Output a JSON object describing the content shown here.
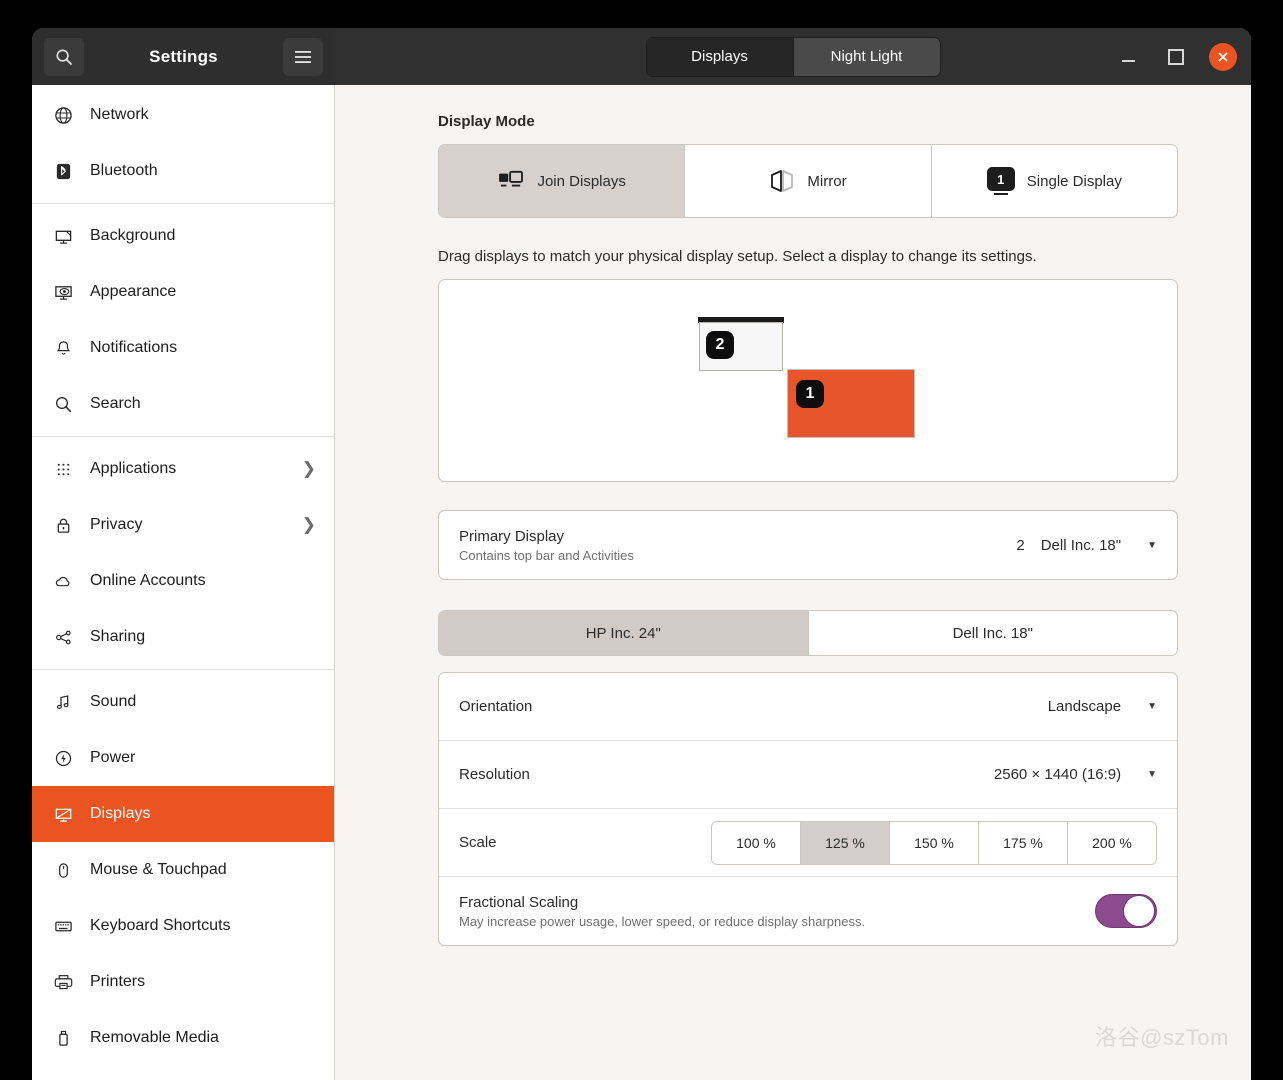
{
  "window": {
    "app_title": "Settings",
    "search_icon": "search-icon",
    "menu_icon": "hamburger-menu-icon",
    "minimize_label": "–",
    "maximize_label": "□",
    "close_label": "✕",
    "accent_color": "#e95420",
    "header_bg": "#303030"
  },
  "header": {
    "tabs": [
      {
        "label": "Displays",
        "active": true
      },
      {
        "label": "Night Light",
        "active": false
      }
    ]
  },
  "sidebar": {
    "groups": [
      {
        "items": [
          {
            "label": "Network",
            "icon": "globe-icon",
            "chevron": false,
            "selected": false
          },
          {
            "label": "Bluetooth",
            "icon": "bluetooth-icon",
            "chevron": false,
            "selected": false
          }
        ]
      },
      {
        "items": [
          {
            "label": "Background",
            "icon": "monitor-wallpaper-icon",
            "chevron": false,
            "selected": false
          },
          {
            "label": "Appearance",
            "icon": "appearance-eye-icon",
            "chevron": false,
            "selected": false
          },
          {
            "label": "Notifications",
            "icon": "bell-icon",
            "chevron": false,
            "selected": false
          },
          {
            "label": "Search",
            "icon": "search-icon",
            "chevron": false,
            "selected": false
          }
        ]
      },
      {
        "items": [
          {
            "label": "Applications",
            "icon": "grid-apps-icon",
            "chevron": true,
            "selected": false
          },
          {
            "label": "Privacy",
            "icon": "lock-icon",
            "chevron": true,
            "selected": false
          },
          {
            "label": "Online Accounts",
            "icon": "cloud-icon",
            "chevron": false,
            "selected": false
          },
          {
            "label": "Sharing",
            "icon": "share-nodes-icon",
            "chevron": false,
            "selected": false
          }
        ]
      },
      {
        "items": [
          {
            "label": "Sound",
            "icon": "music-note-icon",
            "chevron": false,
            "selected": false
          },
          {
            "label": "Power",
            "icon": "power-bolt-icon",
            "chevron": false,
            "selected": false
          },
          {
            "label": "Displays",
            "icon": "displays-icon",
            "chevron": false,
            "selected": true
          },
          {
            "label": "Mouse & Touchpad",
            "icon": "mouse-icon",
            "chevron": false,
            "selected": false
          },
          {
            "label": "Keyboard Shortcuts",
            "icon": "keyboard-icon",
            "chevron": false,
            "selected": false
          },
          {
            "label": "Printers",
            "icon": "printer-icon",
            "chevron": false,
            "selected": false
          },
          {
            "label": "Removable Media",
            "icon": "usb-drive-icon",
            "chevron": false,
            "selected": false
          }
        ]
      }
    ]
  },
  "main": {
    "display_mode": {
      "title": "Display Mode",
      "options": [
        {
          "label": "Join Displays",
          "icon": "join-displays-icon",
          "active": true
        },
        {
          "label": "Mirror",
          "icon": "mirror-icon",
          "active": false
        },
        {
          "label": "Single Display",
          "icon": "single-display-badge-icon",
          "badge": "1",
          "active": false
        }
      ]
    },
    "arrangement": {
      "hint": "Drag displays to match your physical display setup. Select a display to change its settings.",
      "displays": [
        {
          "number": "2",
          "primary": true,
          "selected": false
        },
        {
          "number": "1",
          "primary": false,
          "selected": true
        }
      ]
    },
    "primary_display": {
      "title": "Primary Display",
      "subtitle": "Contains top bar and Activities",
      "value_number": "2",
      "value": "Dell Inc. 18\"",
      "caret_icon": "chevron-down-icon"
    },
    "display_picker": [
      {
        "label": "HP Inc. 24\"",
        "active": true
      },
      {
        "label": "Dell Inc. 18\"",
        "active": false
      }
    ],
    "settings": {
      "orientation": {
        "label": "Orientation",
        "value": "Landscape",
        "caret_icon": "chevron-down-icon"
      },
      "resolution": {
        "label": "Resolution",
        "value": "2560 × 1440 (16:9)",
        "caret_icon": "chevron-down-icon"
      },
      "scale": {
        "label": "Scale",
        "options": [
          {
            "label": "100 %",
            "active": false
          },
          {
            "label": "125 %",
            "active": true
          },
          {
            "label": "150 %",
            "active": false
          },
          {
            "label": "175 %",
            "active": false
          },
          {
            "label": "200 %",
            "active": false
          }
        ]
      },
      "fractional_scaling": {
        "label": "Fractional Scaling",
        "subtitle": "May increase power usage, lower speed, or reduce display sharpness.",
        "enabled": true,
        "toggle_color": "#8e4a8e"
      }
    }
  },
  "watermark": {
    "text": "洛谷@szTom"
  }
}
